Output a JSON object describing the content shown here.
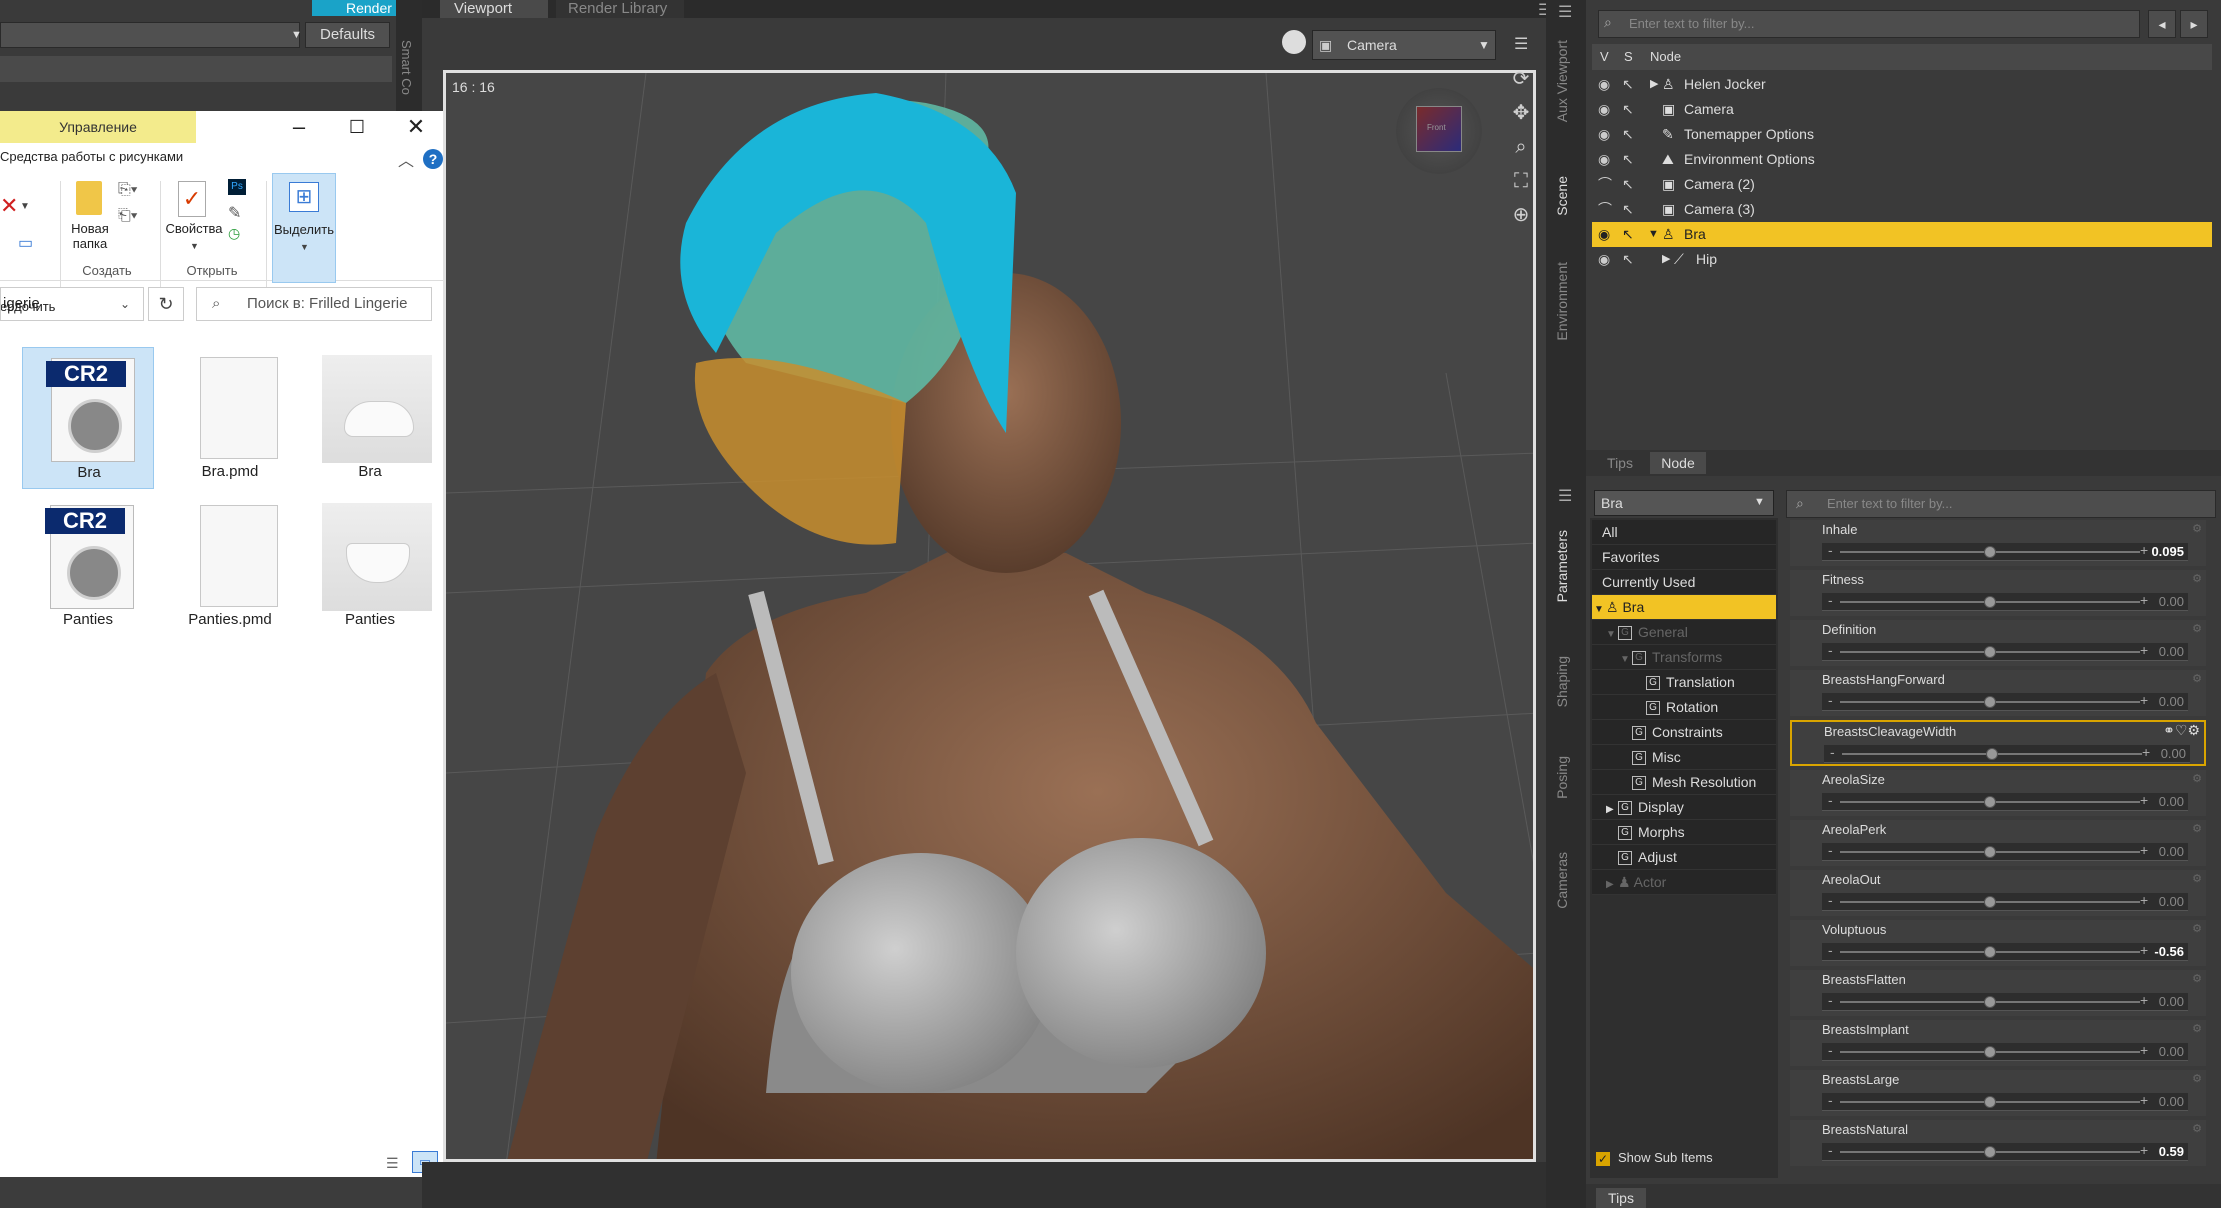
{
  "top_left": {
    "render_label": "Render",
    "defaults_label": "Defaults",
    "smart_tab_label": "Smart Co"
  },
  "explorer": {
    "ribbon_context_tab": "Управление",
    "ribbon_context_sub": "Средства работы с рисунками",
    "ribbon": {
      "move_to_label": "ердочить",
      "new_folder_label_line1": "Новая",
      "new_folder_label_line2": "папка",
      "properties_label": "Свойства",
      "select_label": "Выделить",
      "group_create": "Создать",
      "group_open": "Открыть"
    },
    "address_text": "igerie",
    "search_placeholder": "Поиск в: Frilled Lingerie",
    "files": [
      {
        "name": "Bra",
        "type": "CR2"
      },
      {
        "name": "Bra.pmd",
        "type": "blank"
      },
      {
        "name": "Bra",
        "type": "thumb"
      },
      {
        "name": "Panties",
        "type": "CR2"
      },
      {
        "name": "Panties.pmd",
        "type": "blank"
      },
      {
        "name": "Panties",
        "type": "thumb"
      }
    ]
  },
  "viewport": {
    "tab_active": "Viewport",
    "tab_other": "Render Library",
    "camera_select": "Camera",
    "aspect_ratio": "16 : 16",
    "viewcube_text": "Front"
  },
  "side_tabs_left": [
    "Aux Viewport",
    "Scene",
    "Environment"
  ],
  "side_tabs_right": [
    "Parameters",
    "Shaping",
    "Posing",
    "Cameras"
  ],
  "scene": {
    "filter_placeholder": "Enter text to filter by...",
    "col_v": "V",
    "col_s": "S",
    "col_node": "Node",
    "nodes": [
      {
        "label": "Helen Jocker",
        "expander": "▶",
        "icon": "figure"
      },
      {
        "label": "Camera",
        "expander": "",
        "icon": "camera"
      },
      {
        "label": "Tonemapper Options",
        "expander": "",
        "icon": "tonemapper"
      },
      {
        "label": "Environment Options",
        "expander": "",
        "icon": "environment"
      },
      {
        "label": "Camera (2)",
        "expander": "",
        "icon": "camera"
      },
      {
        "label": "Camera (3)",
        "expander": "",
        "icon": "camera"
      },
      {
        "label": "Bra",
        "expander": "▼",
        "icon": "figure",
        "selected": true
      },
      {
        "label": "Hip",
        "expander": "▶",
        "icon": "bone"
      }
    ],
    "tab_tips": "Tips",
    "tab_node": "Node"
  },
  "parameters": {
    "node_select": "Bra",
    "filter_placeholder": "Enter text to filter by...",
    "tree": [
      {
        "label": "All"
      },
      {
        "label": "Favorites"
      },
      {
        "label": "Currently Used"
      },
      {
        "label": "Bra",
        "selected": true
      },
      {
        "label": "General"
      },
      {
        "label": "Transforms"
      },
      {
        "label": "Translation"
      },
      {
        "label": "Rotation"
      },
      {
        "label": "Constraints"
      },
      {
        "label": "Misc"
      },
      {
        "label": "Mesh Resolution"
      },
      {
        "label": "Display"
      },
      {
        "label": "Morphs"
      },
      {
        "label": "Adjust"
      },
      {
        "label": "Actor"
      }
    ],
    "show_sub_items": "Show Sub Items",
    "sliders": [
      {
        "name": "Inhale",
        "value": "0.095",
        "level": 0.5
      },
      {
        "name": "Fitness",
        "value": "0.00",
        "level": 0.5
      },
      {
        "name": "Definition",
        "value": "0.00",
        "level": 0.5
      },
      {
        "name": "BreastsHangForward",
        "value": "0.00",
        "level": 0.5
      },
      {
        "name": "BreastsCleavageWidth",
        "value": "0.00",
        "level": 0.5,
        "selected": true
      },
      {
        "name": "AreolaSize",
        "value": "0.00",
        "level": 0.5
      },
      {
        "name": "AreolaPerk",
        "value": "0.00",
        "level": 0.5
      },
      {
        "name": "AreolaOut",
        "value": "0.00",
        "level": 0.5
      },
      {
        "name": "Voluptuous",
        "value": "-0.56",
        "level": 0.5
      },
      {
        "name": "BreastsFlatten",
        "value": "0.00",
        "level": 0.5
      },
      {
        "name": "BreastsImplant",
        "value": "0.00",
        "level": 0.5
      },
      {
        "name": "BreastsLarge",
        "value": "0.00",
        "level": 0.5
      },
      {
        "name": "BreastsNatural",
        "value": "0.59",
        "level": 0.5
      }
    ],
    "bottom_tab": "Tips"
  },
  "colors": {
    "accent": "#f2c324",
    "render_button": "#1aa3c8",
    "hair": "#1ab5d8"
  }
}
